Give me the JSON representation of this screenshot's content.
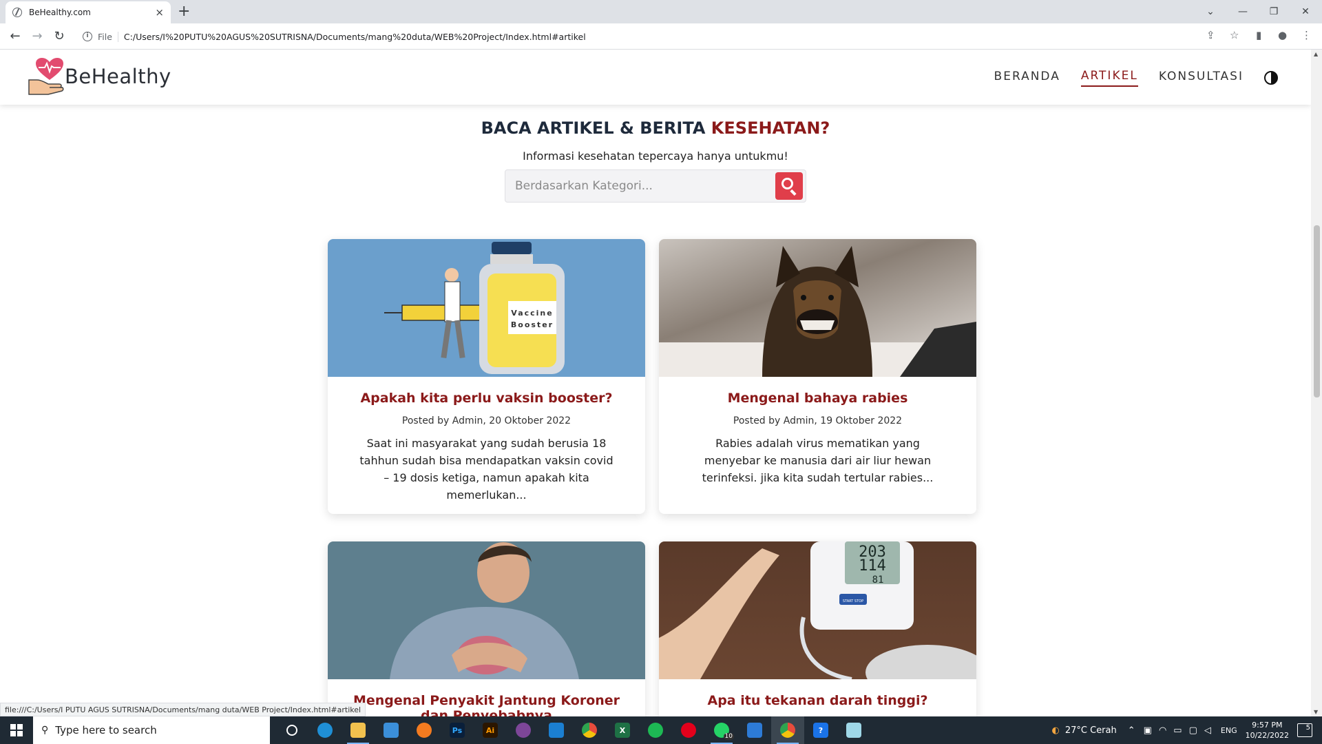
{
  "browser": {
    "tab_title": "BeHealthy.com",
    "tab_close": "×",
    "new_tab": "+",
    "omnibox_scheme": "File",
    "url": "C:/Users/I%20PUTU%20AGUS%20SUTRISNA/Documents/mang%20duta/WEB%20Project/Index.html#artikel",
    "status_url": "file:///C:/Users/I PUTU AGUS SUTRISNA/Documents/mang duta/WEB Project/Index.html#artikel"
  },
  "site": {
    "brand": "BeHealthy",
    "nav": [
      {
        "label": "BERANDA",
        "active": false
      },
      {
        "label": "ARTIKEL",
        "active": true
      },
      {
        "label": "KONSULTASI",
        "active": false
      }
    ]
  },
  "section": {
    "title_main": "BACA ARTIKEL & BERITA ",
    "title_accent": "KESEHATAN?",
    "subtitle": "Informasi kesehatan tepercaya hanya untukmu!",
    "search_placeholder": "Berdasarkan Kategori..."
  },
  "articles": [
    {
      "title": "Apakah kita perlu vaksin booster?",
      "meta": "Posted by Admin, 20 Oktober 2022",
      "excerpt": "Saat ini masyarakat yang sudah berusia 18 tahhun sudah bisa mendapatkan vaksin covid – 19 dosis ketiga, namun apakah kita memerlukan...",
      "image_label": "Vaccine Booster"
    },
    {
      "title": "Mengenal bahaya rabies",
      "meta": "Posted by Admin, 19 Oktober 2022",
      "excerpt": "Rabies adalah virus mematikan yang menyebar ke manusia dari air liur hewan terinfeksi. jika kita sudah tertular rabies..."
    },
    {
      "title": "Mengenal Penyakit Jantung Koroner dan Penyebabnya",
      "meta": "",
      "excerpt": ""
    },
    {
      "title": "Apa itu tekanan darah tinggi?",
      "meta": "",
      "excerpt": "",
      "monitor_readings": [
        "203",
        "114",
        "81"
      ],
      "monitor_button": "START STOP"
    }
  ],
  "taskbar": {
    "search_placeholder": "Type here to search",
    "weather": "27°C  Cerah",
    "language": "ENG",
    "time": "9:57 PM",
    "date": "10/22/2022",
    "notifications": "5",
    "whatsapp_badge": "10"
  },
  "colors": {
    "accent": "#8b1a1a",
    "search_button": "#e03e4a",
    "heading": "#1e2a3b"
  }
}
